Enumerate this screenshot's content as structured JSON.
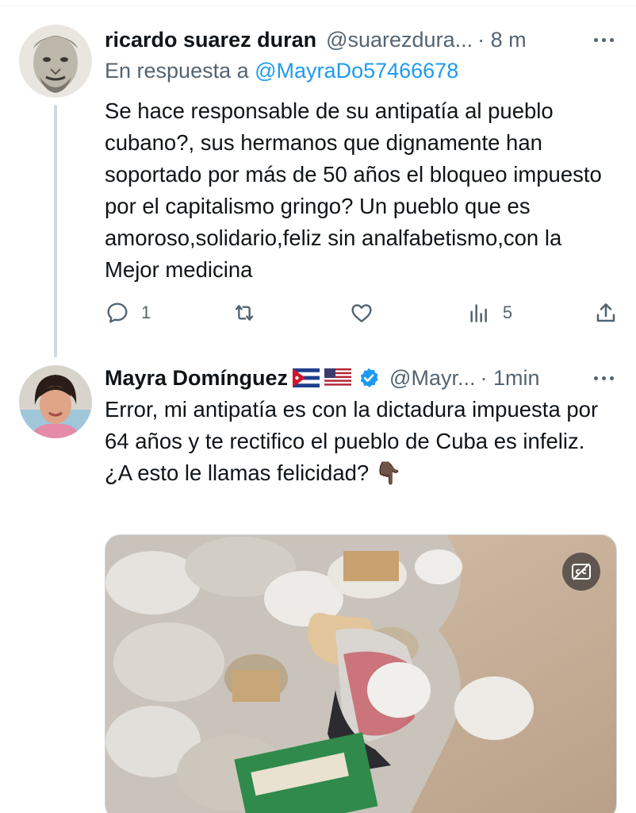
{
  "tweets": [
    {
      "display_name": "ricardo suarez duran",
      "handle": "@suarezdura...",
      "time": "· 8 m",
      "reply_prefix": "En respuesta a",
      "reply_mention": "@MayraDo57466678",
      "text": "Se hace responsable de su antipatía al pueblo cubano?, sus hermanos que dignamente han soportado por más de 50 años el bloqueo impuesto por el capitalismo gringo? Un pueblo que es amoroso,solidario,feliz sin analfabetismo,con la Mejor medicina",
      "actions": {
        "reply_count": "1",
        "retweet_count": "",
        "like_count": "",
        "views_count": "5"
      }
    },
    {
      "display_name": "Mayra Domínguez",
      "flags": [
        "cuba-flag-icon",
        "usa-flag-icon"
      ],
      "handle": "@Mayr...",
      "time": "· 1min",
      "text_lines": [
        "Error, mi antipatía es con la dictadura impuesta por 64 años y te rectifico el pueblo de Cuba es infeliz.",
        "¿A esto le llamas felicidad? 👇🏿"
      ]
    }
  ],
  "colors": {
    "text": "#0f1419",
    "secondary": "#536471",
    "link": "#1d9bf0",
    "thread_line": "#cfd9de",
    "verified": "#1d9bf0"
  }
}
